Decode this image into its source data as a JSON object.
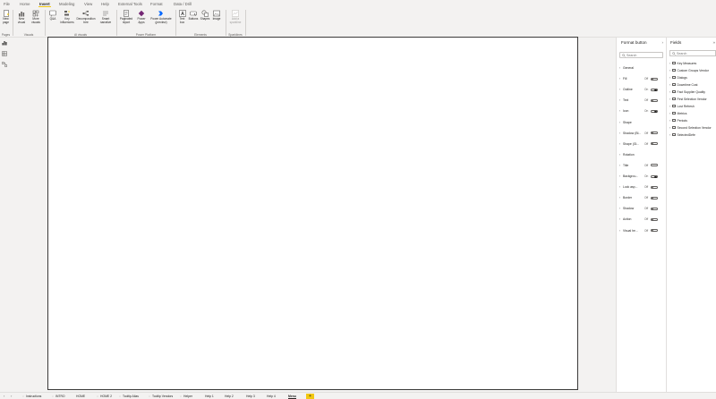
{
  "ribbon": {
    "tabs": [
      "File",
      "Home",
      "Insert",
      "Modeling",
      "View",
      "Help",
      "External Tools",
      "Format",
      "Data / Drill"
    ],
    "active_tab": "Insert",
    "groups": {
      "pages": {
        "label": "Pages",
        "buttons": [
          "New page",
          "New visual"
        ]
      },
      "visuals": {
        "label": "Visuals",
        "buttons": [
          "More visuals"
        ]
      },
      "ai": {
        "label": "AI visuals",
        "buttons": [
          "Q&A",
          "Key influencers",
          "Decomposition tree",
          "Smart narrative"
        ]
      },
      "power": {
        "label": "Power Platform",
        "buttons": [
          "Paginated report",
          "Power Apps",
          "Power Automate (preview)"
        ]
      },
      "elements": {
        "label": "Elements",
        "buttons": [
          "Text box",
          "Buttons",
          "Shapes",
          "Image"
        ]
      },
      "sparklines": {
        "label": "Sparklines",
        "buttons": [
          "Add a sparkline"
        ]
      }
    }
  },
  "format_pane": {
    "title": "Format button",
    "search_placeholder": "Search",
    "sections": [
      {
        "label": "General",
        "toggle": null
      },
      {
        "label": "Fill",
        "toggle": "Off"
      },
      {
        "label": "Outline",
        "toggle": "On"
      },
      {
        "label": "Text",
        "toggle": "Off"
      },
      {
        "label": "Icon",
        "toggle": "On"
      },
      {
        "label": "Shape",
        "toggle": null
      },
      {
        "label": "Shadow (Bl...",
        "toggle": "Off"
      },
      {
        "label": "Shape (Gl...",
        "toggle": "Off"
      },
      {
        "label": "Rotation",
        "toggle": null
      },
      {
        "label": "Title",
        "toggle": "Off"
      },
      {
        "label": "Backgrou...",
        "toggle": "On"
      },
      {
        "label": "Lock asp...",
        "toggle": "Off"
      },
      {
        "label": "Border",
        "toggle": "Off"
      },
      {
        "label": "Shadow",
        "toggle": "Off"
      },
      {
        "label": "Action",
        "toggle": "Off"
      },
      {
        "label": "Visual he...",
        "toggle": "Off"
      }
    ]
  },
  "fields_pane": {
    "title": "Fields",
    "search_placeholder": "Search",
    "tables": [
      "Key Measures",
      "Custom Groups Vendor",
      "Dialogs",
      "Downtime Cost",
      "Fact Supplier Quality",
      "First Selection Vendor",
      "Lost Refresh",
      "Metrics",
      "Periods",
      "Second Selection Vendor",
      "SelectedDefe"
    ]
  },
  "page_tabs": {
    "tabs": [
      {
        "label": "Instructions",
        "hidden": true
      },
      {
        "label": "INTRO",
        "hidden": true
      },
      {
        "label": "HOME",
        "hidden": false
      },
      {
        "label": "HOME 2",
        "hidden": true
      },
      {
        "label": "Tooltip Alias",
        "hidden": true
      },
      {
        "label": "Tooltip Vendors",
        "hidden": true
      },
      {
        "label": "Helper",
        "hidden": true
      },
      {
        "label": "Help 1",
        "hidden": false
      },
      {
        "label": "Help 2",
        "hidden": false
      },
      {
        "label": "Help 3",
        "hidden": false
      },
      {
        "label": "Help 4",
        "hidden": false
      },
      {
        "label": "Menu",
        "hidden": false
      }
    ],
    "active": "Menu",
    "add_label": "+"
  },
  "colors": {
    "accent": "#f2c811",
    "ribbon_bg": "#f3f2f1",
    "pane_bg": "#ffffff",
    "canvas_border": "#3b3a39"
  }
}
